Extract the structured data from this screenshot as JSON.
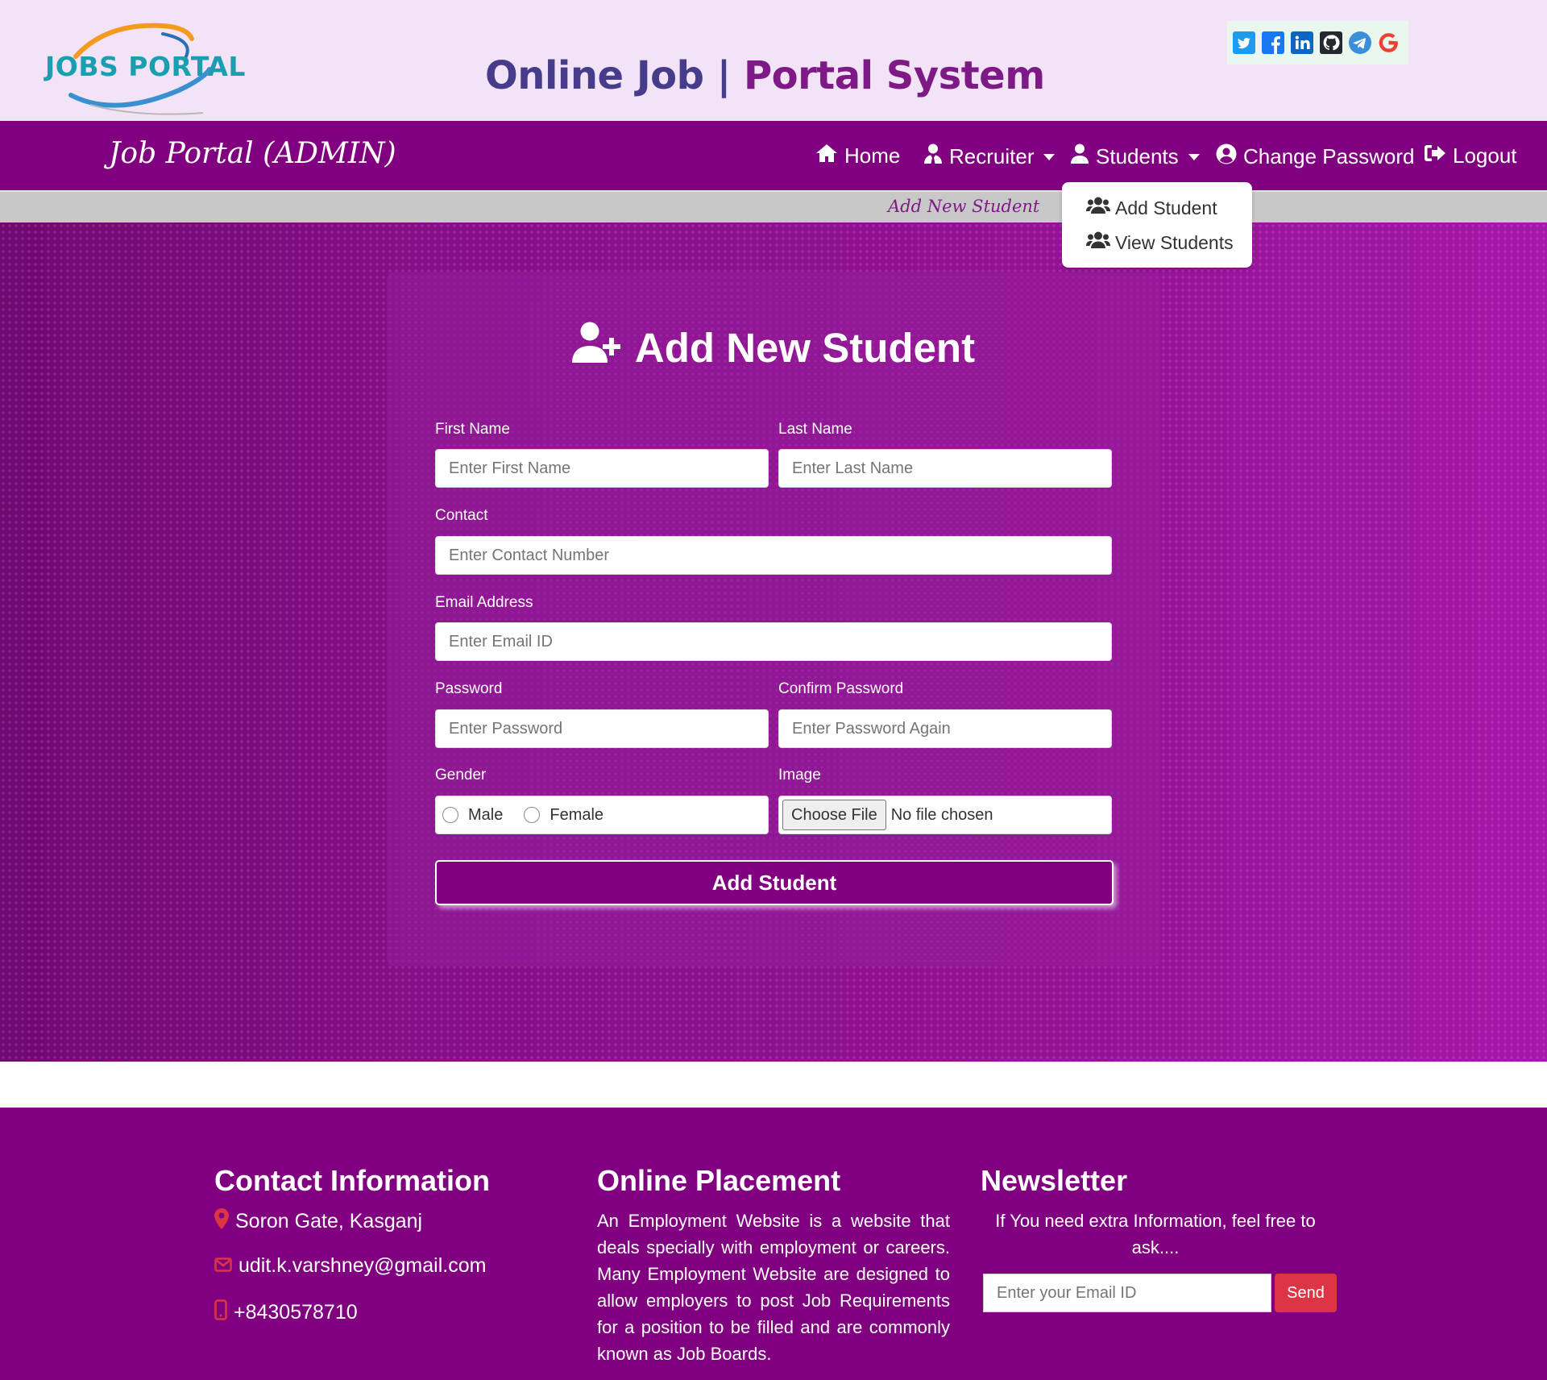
{
  "header": {
    "logo_text_1": "JOBS",
    "logo_text_2": "PORTAL",
    "title_part1": "Online Job",
    "title_separator": " | ",
    "title_part2": "Portal System",
    "social_icons": [
      "twitter-icon",
      "facebook-icon",
      "linkedin-icon",
      "github-icon",
      "telegram-icon",
      "google-icon"
    ]
  },
  "navbar": {
    "brand": "Job Portal (ADMIN)",
    "items": [
      {
        "label": "Home",
        "icon": "home-icon"
      },
      {
        "label": "Recruiter",
        "icon": "user-tie-icon"
      },
      {
        "label": "Students",
        "icon": "user-icon"
      },
      {
        "label": "Change Password",
        "icon": "user-circle-icon"
      },
      {
        "label": "Logout",
        "icon": "sign-out-icon"
      }
    ]
  },
  "sub_bar": {
    "text": "Add New Student"
  },
  "dropdown": {
    "items": [
      {
        "label": "Add Student",
        "icon": "users-icon"
      },
      {
        "label": "View Students",
        "icon": "users-icon"
      }
    ]
  },
  "form": {
    "heading": "Add New Student",
    "first_name": {
      "label": "First Name",
      "placeholder": "Enter First Name"
    },
    "last_name": {
      "label": "Last Name",
      "placeholder": "Enter Last Name"
    },
    "contact": {
      "label": "Contact",
      "placeholder": "Enter Contact Number"
    },
    "email": {
      "label": "Email Address",
      "placeholder": "Enter Email ID"
    },
    "password": {
      "label": "Password",
      "placeholder": "Enter Password"
    },
    "confirm_password": {
      "label": "Confirm Password",
      "placeholder": "Enter Password Again"
    },
    "gender": {
      "label": "Gender",
      "options": [
        "Male",
        "Female"
      ]
    },
    "image": {
      "label": "Image",
      "button": "Choose File",
      "status": "No file chosen"
    },
    "submit": "Add Student"
  },
  "footer": {
    "contact": {
      "heading": "Contact Information",
      "address": "Soron Gate, Kasganj",
      "email": "udit.k.varshney@gmail.com",
      "phone": "+8430578710"
    },
    "placement": {
      "heading": "Online Placement",
      "text": "An Employment Website is a website that deals specially with employment or careers. Many Employment Website are designed to allow employers to post Job Requirements for a position to be filled and are commonly known as Job Boards."
    },
    "newsletter": {
      "heading": "Newsletter",
      "text": "If You need extra Information, feel free to ask....",
      "placeholder": "Enter your Email ID",
      "button": "Send"
    }
  },
  "colors": {
    "primary": "#800080",
    "header_bg": "#f2e3f7",
    "title_dark": "#463c8a",
    "title_accent": "#7d1a86",
    "accent_red": "#dc3545"
  }
}
